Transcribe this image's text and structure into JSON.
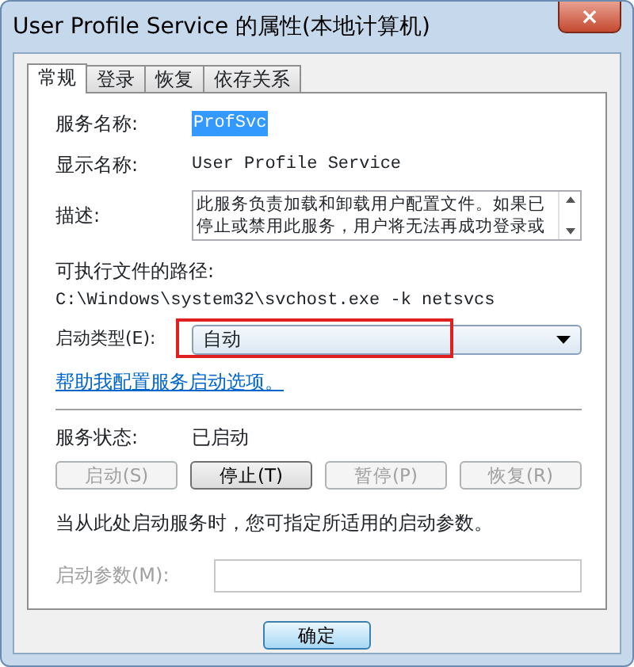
{
  "window": {
    "title": "User Profile Service 的属性(本地计算机)",
    "close": "×"
  },
  "tabs": [
    {
      "label": "常规",
      "selected": true
    },
    {
      "label": "登录",
      "selected": false
    },
    {
      "label": "恢复",
      "selected": false
    },
    {
      "label": "依存关系",
      "selected": false
    }
  ],
  "service_name": {
    "label": "服务名称:",
    "value": "ProfSvc",
    "selected": true
  },
  "display_name": {
    "label": "显示名称:",
    "value": "User Profile Service"
  },
  "description": {
    "label": "描述:",
    "lines": [
      "此服务负责加载和卸载用户配置文件。如果已",
      "停止或禁用此服务，用户将无法再成功登录或"
    ]
  },
  "executable_path": {
    "label": "可执行文件的路径:",
    "value": "C:\\Windows\\system32\\svchost.exe -k netsvcs"
  },
  "startup_type": {
    "label": "启动类型(E):",
    "value": "自动",
    "highlighted": true
  },
  "help_link": "帮助我配置服务启动选项。",
  "service_status": {
    "label": "服务状态:",
    "value": "已启动"
  },
  "service_buttons": [
    {
      "label": "启动(S)",
      "disabled": true
    },
    {
      "label": "停止(T)",
      "disabled": false
    },
    {
      "label": "暂停(P)",
      "disabled": true
    },
    {
      "label": "恢复(R)",
      "disabled": true
    }
  ],
  "note": "当从此处启动服务时，您可指定所适用的启动参数。",
  "start_parameters": {
    "label": "启动参数(M):",
    "disabled": true
  },
  "footer_buttons": [
    {
      "label": "确定",
      "default": true
    }
  ]
}
